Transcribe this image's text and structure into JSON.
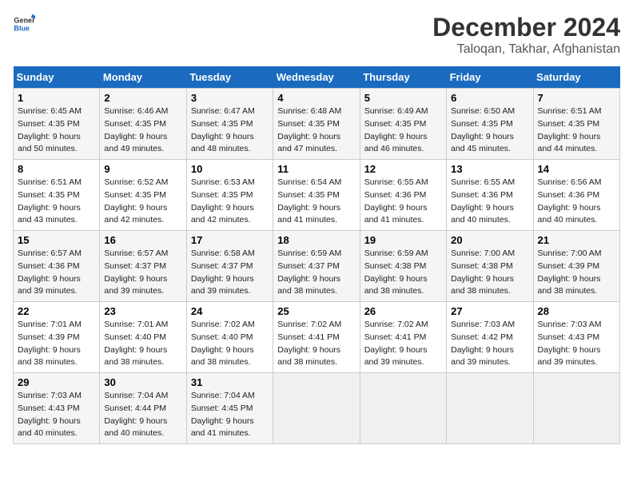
{
  "header": {
    "logo_general": "General",
    "logo_blue": "Blue",
    "title": "December 2024",
    "subtitle": "Taloqan, Takhar, Afghanistan"
  },
  "calendar": {
    "days_of_week": [
      "Sunday",
      "Monday",
      "Tuesday",
      "Wednesday",
      "Thursday",
      "Friday",
      "Saturday"
    ],
    "weeks": [
      [
        {
          "day": "1",
          "sunrise": "6:45 AM",
          "sunset": "4:35 PM",
          "daylight": "9 hours and 50 minutes."
        },
        {
          "day": "2",
          "sunrise": "6:46 AM",
          "sunset": "4:35 PM",
          "daylight": "9 hours and 49 minutes."
        },
        {
          "day": "3",
          "sunrise": "6:47 AM",
          "sunset": "4:35 PM",
          "daylight": "9 hours and 48 minutes."
        },
        {
          "day": "4",
          "sunrise": "6:48 AM",
          "sunset": "4:35 PM",
          "daylight": "9 hours and 47 minutes."
        },
        {
          "day": "5",
          "sunrise": "6:49 AM",
          "sunset": "4:35 PM",
          "daylight": "9 hours and 46 minutes."
        },
        {
          "day": "6",
          "sunrise": "6:50 AM",
          "sunset": "4:35 PM",
          "daylight": "9 hours and 45 minutes."
        },
        {
          "day": "7",
          "sunrise": "6:51 AM",
          "sunset": "4:35 PM",
          "daylight": "9 hours and 44 minutes."
        }
      ],
      [
        {
          "day": "8",
          "sunrise": "6:51 AM",
          "sunset": "4:35 PM",
          "daylight": "9 hours and 43 minutes."
        },
        {
          "day": "9",
          "sunrise": "6:52 AM",
          "sunset": "4:35 PM",
          "daylight": "9 hours and 42 minutes."
        },
        {
          "day": "10",
          "sunrise": "6:53 AM",
          "sunset": "4:35 PM",
          "daylight": "9 hours and 42 minutes."
        },
        {
          "day": "11",
          "sunrise": "6:54 AM",
          "sunset": "4:35 PM",
          "daylight": "9 hours and 41 minutes."
        },
        {
          "day": "12",
          "sunrise": "6:55 AM",
          "sunset": "4:36 PM",
          "daylight": "9 hours and 41 minutes."
        },
        {
          "day": "13",
          "sunrise": "6:55 AM",
          "sunset": "4:36 PM",
          "daylight": "9 hours and 40 minutes."
        },
        {
          "day": "14",
          "sunrise": "6:56 AM",
          "sunset": "4:36 PM",
          "daylight": "9 hours and 40 minutes."
        }
      ],
      [
        {
          "day": "15",
          "sunrise": "6:57 AM",
          "sunset": "4:36 PM",
          "daylight": "9 hours and 39 minutes."
        },
        {
          "day": "16",
          "sunrise": "6:57 AM",
          "sunset": "4:37 PM",
          "daylight": "9 hours and 39 minutes."
        },
        {
          "day": "17",
          "sunrise": "6:58 AM",
          "sunset": "4:37 PM",
          "daylight": "9 hours and 39 minutes."
        },
        {
          "day": "18",
          "sunrise": "6:59 AM",
          "sunset": "4:37 PM",
          "daylight": "9 hours and 38 minutes."
        },
        {
          "day": "19",
          "sunrise": "6:59 AM",
          "sunset": "4:38 PM",
          "daylight": "9 hours and 38 minutes."
        },
        {
          "day": "20",
          "sunrise": "7:00 AM",
          "sunset": "4:38 PM",
          "daylight": "9 hours and 38 minutes."
        },
        {
          "day": "21",
          "sunrise": "7:00 AM",
          "sunset": "4:39 PM",
          "daylight": "9 hours and 38 minutes."
        }
      ],
      [
        {
          "day": "22",
          "sunrise": "7:01 AM",
          "sunset": "4:39 PM",
          "daylight": "9 hours and 38 minutes."
        },
        {
          "day": "23",
          "sunrise": "7:01 AM",
          "sunset": "4:40 PM",
          "daylight": "9 hours and 38 minutes."
        },
        {
          "day": "24",
          "sunrise": "7:02 AM",
          "sunset": "4:40 PM",
          "daylight": "9 hours and 38 minutes."
        },
        {
          "day": "25",
          "sunrise": "7:02 AM",
          "sunset": "4:41 PM",
          "daylight": "9 hours and 38 minutes."
        },
        {
          "day": "26",
          "sunrise": "7:02 AM",
          "sunset": "4:41 PM",
          "daylight": "9 hours and 39 minutes."
        },
        {
          "day": "27",
          "sunrise": "7:03 AM",
          "sunset": "4:42 PM",
          "daylight": "9 hours and 39 minutes."
        },
        {
          "day": "28",
          "sunrise": "7:03 AM",
          "sunset": "4:43 PM",
          "daylight": "9 hours and 39 minutes."
        }
      ],
      [
        {
          "day": "29",
          "sunrise": "7:03 AM",
          "sunset": "4:43 PM",
          "daylight": "9 hours and 40 minutes."
        },
        {
          "day": "30",
          "sunrise": "7:04 AM",
          "sunset": "4:44 PM",
          "daylight": "9 hours and 40 minutes."
        },
        {
          "day": "31",
          "sunrise": "7:04 AM",
          "sunset": "4:45 PM",
          "daylight": "9 hours and 41 minutes."
        },
        null,
        null,
        null,
        null
      ]
    ]
  }
}
